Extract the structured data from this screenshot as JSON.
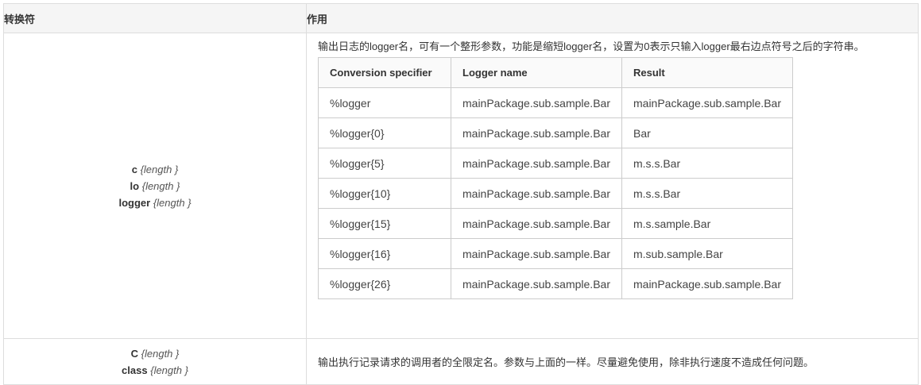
{
  "header": {
    "col1": "转换符",
    "col2": "作用"
  },
  "rows": [
    {
      "specs": [
        {
          "name": "c",
          "arg": "length"
        },
        {
          "name": "lo",
          "arg": "length"
        },
        {
          "name": "logger",
          "arg": "length"
        }
      ],
      "description": "输出日志的logger名，可有一个整形参数，功能是缩短logger名，设置为0表示只输入logger最右边点符号之后的字符串。",
      "example_table": {
        "headers": [
          "Conversion specifier",
          "Logger name",
          "Result"
        ],
        "rows": [
          [
            "%logger",
            "mainPackage.sub.sample.Bar",
            "mainPackage.sub.sample.Bar"
          ],
          [
            "%logger{0}",
            "mainPackage.sub.sample.Bar",
            "Bar"
          ],
          [
            "%logger{5}",
            "mainPackage.sub.sample.Bar",
            "m.s.s.Bar"
          ],
          [
            "%logger{10}",
            "mainPackage.sub.sample.Bar",
            "m.s.s.Bar"
          ],
          [
            "%logger{15}",
            "mainPackage.sub.sample.Bar",
            "m.s.sample.Bar"
          ],
          [
            "%logger{16}",
            "mainPackage.sub.sample.Bar",
            "m.sub.sample.Bar"
          ],
          [
            "%logger{26}",
            "mainPackage.sub.sample.Bar",
            "mainPackage.sub.sample.Bar"
          ]
        ]
      }
    },
    {
      "specs": [
        {
          "name": "C",
          "arg": "length"
        },
        {
          "name": "class",
          "arg": "length"
        }
      ],
      "description": "输出执行记录请求的调用者的全限定名。参数与上面的一样。尽量避免使用，除非执行速度不造成任何问题。"
    }
  ]
}
